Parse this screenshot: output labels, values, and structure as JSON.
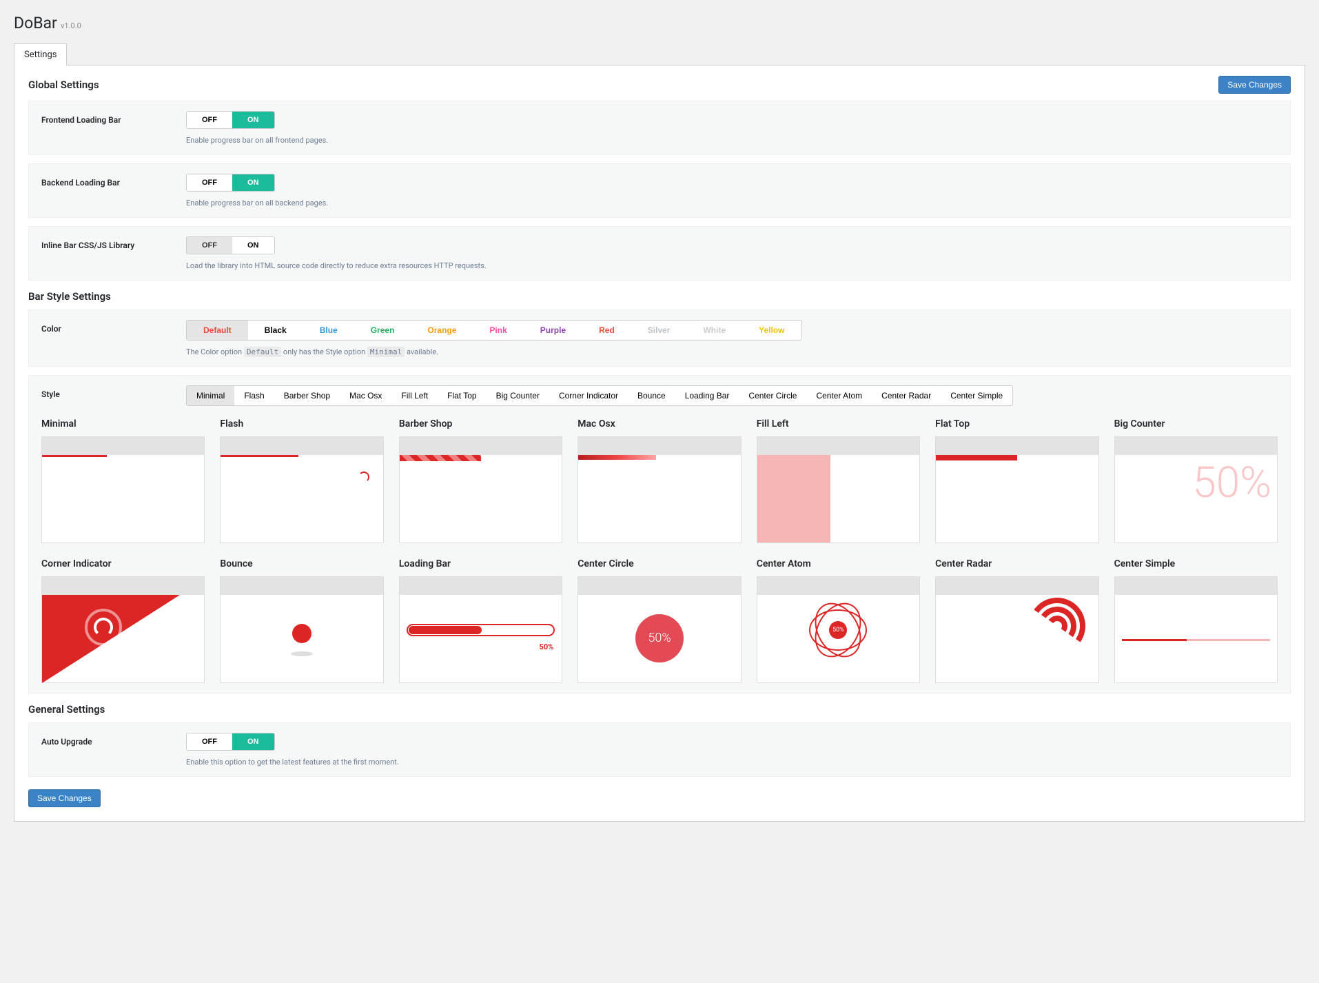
{
  "app": {
    "name": "DoBar",
    "version": "v1.0.0"
  },
  "tabs": {
    "settings": "Settings"
  },
  "buttons": {
    "save_changes": "Save Changes"
  },
  "toggle": {
    "on": "ON",
    "off": "OFF"
  },
  "sections": {
    "global": "Global Settings",
    "bar_style": "Bar Style Settings",
    "general": "General Settings"
  },
  "fields": {
    "frontend": {
      "label": "Frontend Loading Bar",
      "help": "Enable progress bar on all frontend pages.",
      "value": "on"
    },
    "backend": {
      "label": "Backend Loading Bar",
      "help": "Enable progress bar on all backend pages.",
      "value": "on"
    },
    "inline": {
      "label": "Inline Bar CSS/JS Library",
      "help": "Load the library into HTML source code directly to reduce extra resources HTTP requests.",
      "value": "off"
    },
    "color": {
      "label": "Color",
      "help_prefix": "The Color option ",
      "help_code1": "Default",
      "help_mid": " only has the Style option ",
      "help_code2": "Minimal",
      "help_suffix": " available."
    },
    "style": {
      "label": "Style"
    },
    "auto_upgrade": {
      "label": "Auto Upgrade",
      "help": "Enable this option to get the latest features at the first moment.",
      "value": "on"
    }
  },
  "colors": [
    {
      "label": "Default",
      "css": "#e74c3c",
      "selected": true
    },
    {
      "label": "Black",
      "css": "#000"
    },
    {
      "label": "Blue",
      "css": "#3498db"
    },
    {
      "label": "Green",
      "css": "#27ae60"
    },
    {
      "label": "Orange",
      "css": "#f39c12"
    },
    {
      "label": "Pink",
      "css": "#ff4da6"
    },
    {
      "label": "Purple",
      "css": "#8e44ad"
    },
    {
      "label": "Red",
      "css": "#e74c3c"
    },
    {
      "label": "Silver",
      "css": "#bdc3c7"
    },
    {
      "label": "White",
      "css": "#ccc"
    },
    {
      "label": "Yellow",
      "css": "#f1c40f"
    }
  ],
  "styles": [
    "Minimal",
    "Flash",
    "Barber Shop",
    "Mac Osx",
    "Fill Left",
    "Flat Top",
    "Big Counter",
    "Corner Indicator",
    "Bounce",
    "Loading Bar",
    "Center Circle",
    "Center Atom",
    "Center Radar",
    "Center Simple"
  ],
  "style_selected": "Minimal",
  "preview_text": {
    "big_counter": "50%",
    "loading_bar_pct": "50%",
    "center_circle": "50%",
    "center_atom": "50%"
  }
}
